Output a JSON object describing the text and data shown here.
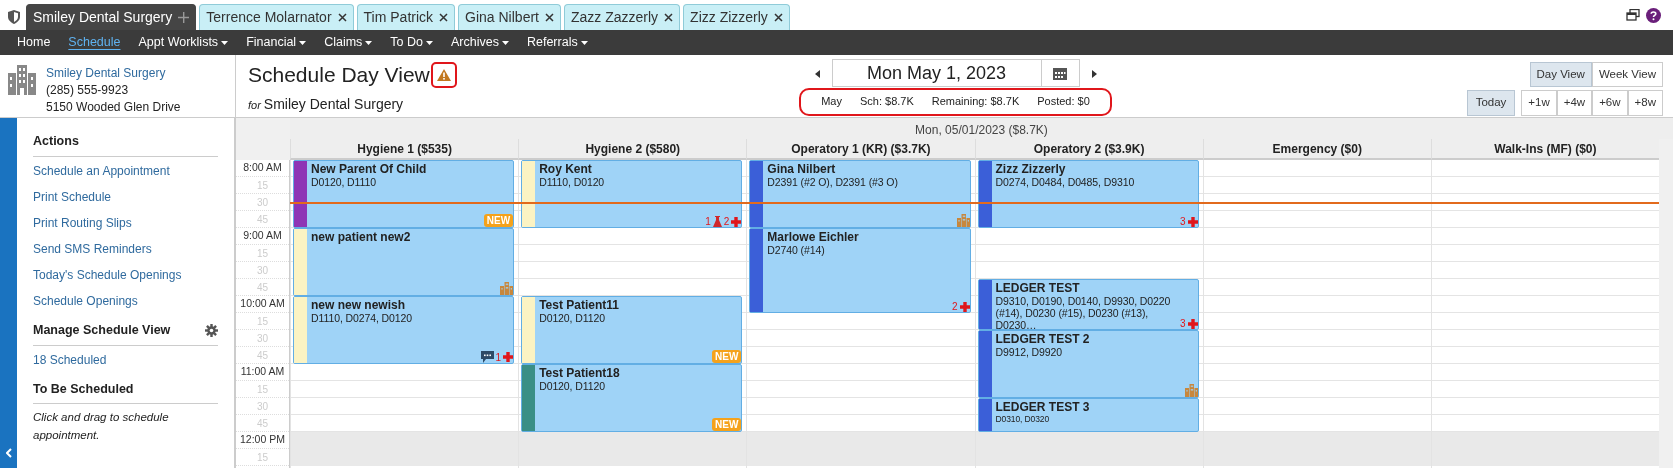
{
  "tabs": [
    {
      "label": "Smiley Dental Surgery",
      "selected": true
    },
    {
      "label": "Terrence Molarnator",
      "selected": false
    },
    {
      "label": "Tim Patrick",
      "selected": false
    },
    {
      "label": "Gina Nilbert",
      "selected": false
    },
    {
      "label": "Zazz Zazzerly",
      "selected": false
    },
    {
      "label": "Zizz Zizzerly",
      "selected": false
    }
  ],
  "nav": [
    {
      "label": "Home",
      "selected": false,
      "dropdown": false
    },
    {
      "label": "Schedule",
      "selected": true,
      "dropdown": false
    },
    {
      "label": "Appt Worklists",
      "selected": false,
      "dropdown": true
    },
    {
      "label": "Financial",
      "selected": false,
      "dropdown": true
    },
    {
      "label": "Claims",
      "selected": false,
      "dropdown": true
    },
    {
      "label": "To Do",
      "selected": false,
      "dropdown": true
    },
    {
      "label": "Archives",
      "selected": false,
      "dropdown": true
    },
    {
      "label": "Referrals",
      "selected": false,
      "dropdown": true
    }
  ],
  "practice": {
    "name": "Smiley Dental Surgery",
    "phone": "(285) 555-9923",
    "address": "5150 Wooded Glen Drive"
  },
  "page": {
    "title": "Schedule Day View",
    "warning_highlighted": true,
    "for_label": "for",
    "location": "Smiley Dental Surgery"
  },
  "date_nav": {
    "date": "Mon May 1, 2023"
  },
  "summary": {
    "highlighted": true,
    "items": [
      "May",
      "Sch: $8.7K",
      "Remaining: $8.7K",
      "Posted: $0"
    ]
  },
  "view_buttons": [
    {
      "label": "Day View",
      "selected": true
    },
    {
      "label": "Week View",
      "selected": false
    }
  ],
  "jump_buttons": [
    {
      "label": "Today",
      "selected": true
    },
    {
      "label": "+1w",
      "selected": false
    },
    {
      "label": "+4w",
      "selected": false
    },
    {
      "label": "+6w",
      "selected": false
    },
    {
      "label": "+8w",
      "selected": false
    }
  ],
  "sidebar": [
    {
      "heading": "Actions",
      "gear": false,
      "links": [
        "Schedule an Appointment",
        "Print Schedule",
        "Print Routing Slips",
        "Send SMS Reminders",
        "Today's Schedule Openings",
        "Schedule Openings"
      ]
    },
    {
      "heading": "Manage Schedule View",
      "gear": true,
      "links": [
        "18 Scheduled"
      ]
    },
    {
      "heading": "To Be Scheduled",
      "gear": false,
      "note": "Click and drag to schedule appointment."
    }
  ],
  "schedule": {
    "day_header": "Mon, 05/01/2023 ($8.7K)",
    "times": [
      {
        "label": "8:00 AM"
      },
      {
        "label": "15"
      },
      {
        "label": "30",
        "now": true
      },
      {
        "label": "45"
      },
      {
        "label": "9:00 AM"
      },
      {
        "label": "15"
      },
      {
        "label": "30"
      },
      {
        "label": "45"
      },
      {
        "label": "10:00 AM"
      },
      {
        "label": "15"
      },
      {
        "label": "30"
      },
      {
        "label": "45"
      },
      {
        "label": "11:00 AM"
      },
      {
        "label": "15"
      },
      {
        "label": "30"
      },
      {
        "label": "45"
      },
      {
        "label": "12:00 PM",
        "closed": true
      },
      {
        "label": "15",
        "closed": true
      }
    ],
    "columns": [
      {
        "name": "Hygiene 1 ($535)",
        "slots": [
          {
            "kind": "appointment",
            "name": "New Parent Of Child",
            "codes": "D0120, D1110",
            "color": "#8e35b5",
            "marks": [
              {
                "kind": "new",
                "text": "NEW"
              }
            ]
          },
          {
            "kind": "cont"
          },
          {
            "kind": "cont"
          },
          {
            "kind": "cont"
          },
          {
            "kind": "appointment",
            "name": "new patient new2",
            "color": "#fbf3c3",
            "marks": [
              {
                "kind": "building"
              }
            ]
          },
          {
            "kind": "cont"
          },
          {
            "kind": "cont"
          },
          {
            "kind": "cont"
          },
          {
            "kind": "appointment",
            "name": "new new newish",
            "codes": "D1110, D0274, D0120",
            "color": "#fbf3c3",
            "marks": [
              {
                "kind": "chat"
              },
              {
                "kind": "count",
                "text": "1"
              },
              {
                "kind": "cross"
              }
            ]
          },
          {
            "kind": "cont"
          },
          {
            "kind": "cont"
          },
          {
            "kind": "cont"
          },
          {
            "kind": "free"
          },
          {
            "kind": "free"
          },
          {
            "kind": "free"
          },
          {
            "kind": "free"
          },
          {
            "kind": "free"
          },
          {
            "kind": "free"
          }
        ]
      },
      {
        "name": "Hygiene 2 ($580)",
        "slots": [
          {
            "kind": "appointment",
            "name": "Roy Kent",
            "codes": "D1110, D0120",
            "color": "#fbf3c3",
            "marks": [
              {
                "kind": "count",
                "text": "1"
              },
              {
                "kind": "flask"
              },
              {
                "kind": "count",
                "text": "2"
              },
              {
                "kind": "cross"
              }
            ]
          },
          {
            "kind": "cont"
          },
          {
            "kind": "cont"
          },
          {
            "kind": "cont"
          },
          {
            "kind": "free"
          },
          {
            "kind": "free"
          },
          {
            "kind": "free"
          },
          {
            "kind": "free"
          },
          {
            "kind": "appointment",
            "name": "Test Patient11",
            "codes": "D0120, D1120",
            "color": "#fbf3c3",
            "marks": [
              {
                "kind": "new",
                "text": "NEW"
              }
            ]
          },
          {
            "kind": "cont"
          },
          {
            "kind": "cont"
          },
          {
            "kind": "cont"
          },
          {
            "kind": "appointment",
            "name": "Test Patient18",
            "codes": "D0120, D1120",
            "color": "#3a8f86",
            "marks": [
              {
                "kind": "new",
                "text": "NEW"
              }
            ]
          },
          {
            "kind": "cont"
          },
          {
            "kind": "cont"
          },
          {
            "kind": "cont"
          },
          {
            "kind": "free"
          },
          {
            "kind": "free"
          }
        ]
      },
      {
        "name": "Operatory 1 (KR) ($3.7K)",
        "slots": [
          {
            "kind": "appointment",
            "name": "Gina Nilbert",
            "codes": "D2391 (#2 O), D2391 (#3 O)",
            "color": "#3b5fd8",
            "marks": [
              {
                "kind": "building"
              }
            ]
          },
          {
            "kind": "cont"
          },
          {
            "kind": "cont"
          },
          {
            "kind": "cont"
          },
          {
            "kind": "appointment",
            "name": "Marlowe Eichler",
            "codes": "D2740 (#14)",
            "color": "#3b5fd8",
            "marks": [
              {
                "kind": "count",
                "text": "2"
              },
              {
                "kind": "cross"
              }
            ]
          },
          {
            "kind": "cont"
          },
          {
            "kind": "cont"
          },
          {
            "kind": "cont"
          },
          {
            "kind": "cont"
          },
          {
            "kind": "free"
          },
          {
            "kind": "free"
          },
          {
            "kind": "free"
          },
          {
            "kind": "free"
          },
          {
            "kind": "free"
          },
          {
            "kind": "free"
          },
          {
            "kind": "free"
          },
          {
            "kind": "free"
          },
          {
            "kind": "free"
          }
        ]
      },
      {
        "name": "Operatory 2 ($3.9K)",
        "slots": [
          {
            "kind": "appointment",
            "name": "Zizz Zizzerly",
            "codes": "D0274, D0484, D0485, D9310",
            "color": "#3b5fd8",
            "marks": [
              {
                "kind": "count",
                "text": "3"
              },
              {
                "kind": "cross"
              }
            ]
          },
          {
            "kind": "cont"
          },
          {
            "kind": "cont"
          },
          {
            "kind": "cont"
          },
          {
            "kind": "free"
          },
          {
            "kind": "free"
          },
          {
            "kind": "free"
          },
          {
            "kind": "appointment",
            "name": "LEDGER TEST",
            "codes": "D9310, D0190, D0140, D9930, D0220 (#14), D0230 (#15), D0230 (#13), D0230…",
            "color": "#3b5fd8",
            "marks": [
              {
                "kind": "count",
                "text": "3"
              },
              {
                "kind": "cross"
              }
            ]
          },
          {
            "kind": "cont"
          },
          {
            "kind": "cont"
          },
          {
            "kind": "appointment",
            "name": "LEDGER TEST 2",
            "codes": "D9912, D9920",
            "color": "#3b5fd8",
            "marks": [
              {
                "kind": "building"
              }
            ]
          },
          {
            "kind": "cont"
          },
          {
            "kind": "cont"
          },
          {
            "kind": "cont"
          },
          {
            "kind": "appointment",
            "name": "LEDGER TEST 3",
            "codes": "D0310, D0320",
            "compact": true,
            "color": "#3b5fd8"
          },
          {
            "kind": "cont"
          },
          {
            "kind": "free"
          },
          {
            "kind": "free"
          }
        ]
      },
      {
        "name": "Emergency ($0)",
        "slots": [
          {
            "kind": "free"
          },
          {
            "kind": "free"
          },
          {
            "kind": "free"
          },
          {
            "kind": "free"
          },
          {
            "kind": "free"
          },
          {
            "kind": "free"
          },
          {
            "kind": "free"
          },
          {
            "kind": "free"
          },
          {
            "kind": "free"
          },
          {
            "kind": "free"
          },
          {
            "kind": "free"
          },
          {
            "kind": "free"
          },
          {
            "kind": "free"
          },
          {
            "kind": "free"
          },
          {
            "kind": "free"
          },
          {
            "kind": "free"
          },
          {
            "kind": "free"
          },
          {
            "kind": "free"
          }
        ]
      },
      {
        "name": "Walk-Ins (MF) ($0)",
        "slots": [
          {
            "kind": "free"
          },
          {
            "kind": "free"
          },
          {
            "kind": "free"
          },
          {
            "kind": "free"
          },
          {
            "kind": "free"
          },
          {
            "kind": "free"
          },
          {
            "kind": "free"
          },
          {
            "kind": "free"
          },
          {
            "kind": "free"
          },
          {
            "kind": "free"
          },
          {
            "kind": "free"
          },
          {
            "kind": "free"
          },
          {
            "kind": "free"
          },
          {
            "kind": "free"
          },
          {
            "kind": "free"
          },
          {
            "kind": "free"
          },
          {
            "kind": "free"
          },
          {
            "kind": "free"
          }
        ]
      }
    ]
  }
}
